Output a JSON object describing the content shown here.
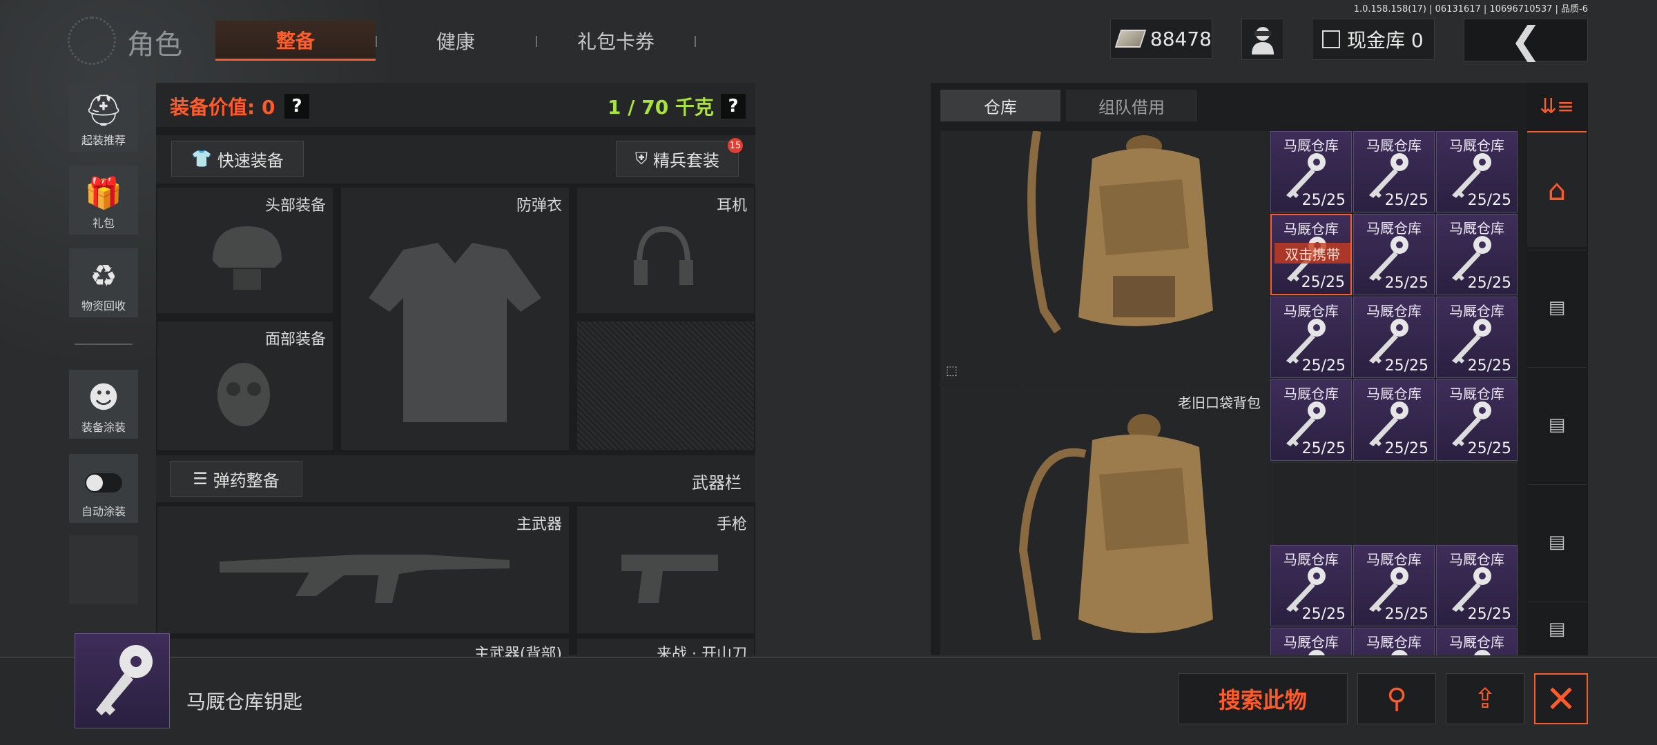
{
  "version": "1.0.158.158(17) | 06131617 | 10696710537 | 品质-6",
  "header": {
    "title": "角色",
    "tabs": [
      {
        "label": "整备"
      },
      {
        "label": "健康"
      },
      {
        "label": "礼包卡券"
      }
    ],
    "currency": "88478",
    "vault_label": "现金库 0",
    "icons": {
      "currency": "banknote-icon",
      "avatar": "operator-icon",
      "vault": "vault-icon",
      "back": "chevron-left-icon"
    }
  },
  "sidebar": {
    "items": [
      {
        "label": "起装推荐",
        "icon": "helmet-grid-icon"
      },
      {
        "label": "礼包",
        "icon": "gift-icon"
      },
      {
        "label": "物资回收",
        "icon": "recycle-face-icon"
      },
      {
        "label": "装备涂装",
        "icon": "soldier-paint-icon"
      },
      {
        "label": "自动涂装",
        "icon": "toggle-icon"
      }
    ]
  },
  "equipment": {
    "value_label": "装备价值: 0",
    "weight_label": "1 / 70 千克",
    "help": "?",
    "quick_equip": "快速装备",
    "elite_set": "精兵套装",
    "elite_badge": "15",
    "slots": {
      "head": "头部装备",
      "armor": "防弹衣",
      "headset": "耳机",
      "face": "面部装备"
    },
    "ammo_btn": "弹药整备",
    "weapon_bar": "武器栏",
    "weapon_slots": {
      "primary": "主武器",
      "pistol": "手枪",
      "primary_back": "主武器(背部)",
      "melee": "来战 · 开山刀"
    }
  },
  "storage": {
    "tabs": [
      {
        "label": "仓库"
      },
      {
        "label": "组队借用"
      }
    ],
    "bag_name": "老旧口袋背包",
    "key_label": "马厩仓库",
    "key_qty": "25/25",
    "double_click_hint": "双击携带",
    "rail_icons": [
      "sort-icon",
      "home-icon",
      "storage-box-icon",
      "storage-box-icon",
      "storage-box-icon",
      "storage-box-icon"
    ]
  },
  "selection": {
    "name": "马厩仓库钥匙",
    "search_btn": "搜索此物",
    "icons": {
      "search": "magnifier-icon",
      "upload": "share-upload-icon",
      "close": "close-icon"
    }
  },
  "colors": {
    "accent": "#ff5a2a",
    "weight": "#a9e33d",
    "key_bg": "#3e2d59"
  }
}
